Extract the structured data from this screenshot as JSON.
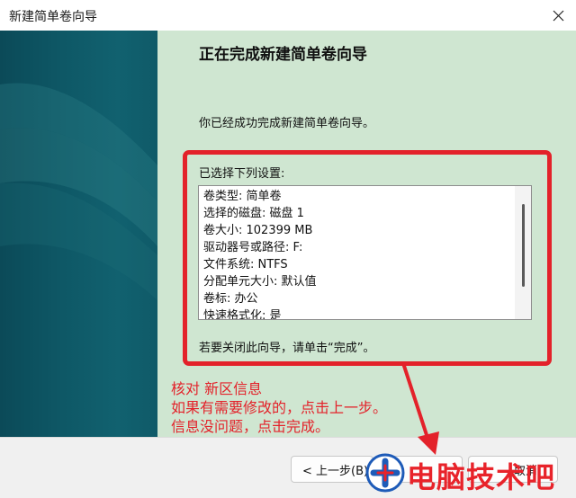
{
  "window": {
    "title": "新建简单卷向导"
  },
  "wizard": {
    "heading": "正在完成新建简单卷向导",
    "done_message": "你已经成功完成新建简单卷向导。",
    "settings_label": "已选择下列设置:",
    "settings_lines": [
      "卷类型: 简单卷",
      "选择的磁盘: 磁盘 1",
      "卷大小: 102399 MB",
      "驱动器号或路径: F:",
      "文件系统: NTFS",
      "分配单元大小: 默认值",
      "卷标: 办公",
      "快速格式化: 是"
    ],
    "close_hint": "若要关闭此向导，请单击“完成”。"
  },
  "annotation": {
    "lines": [
      "核对 新区信息",
      "如果有需要修改的，点击上一步。",
      "信息没问题，点击完成。"
    ]
  },
  "buttons": {
    "back_label": "< 上一步(B)",
    "cancel_label": "取消"
  },
  "watermark": {
    "text": "电脑技术吧",
    "icon": "plus-logo-icon"
  },
  "colors": {
    "annotation_red": "#e3222a",
    "sidebar_teal": "#0e5866",
    "content_green": "#cfe6d1"
  }
}
